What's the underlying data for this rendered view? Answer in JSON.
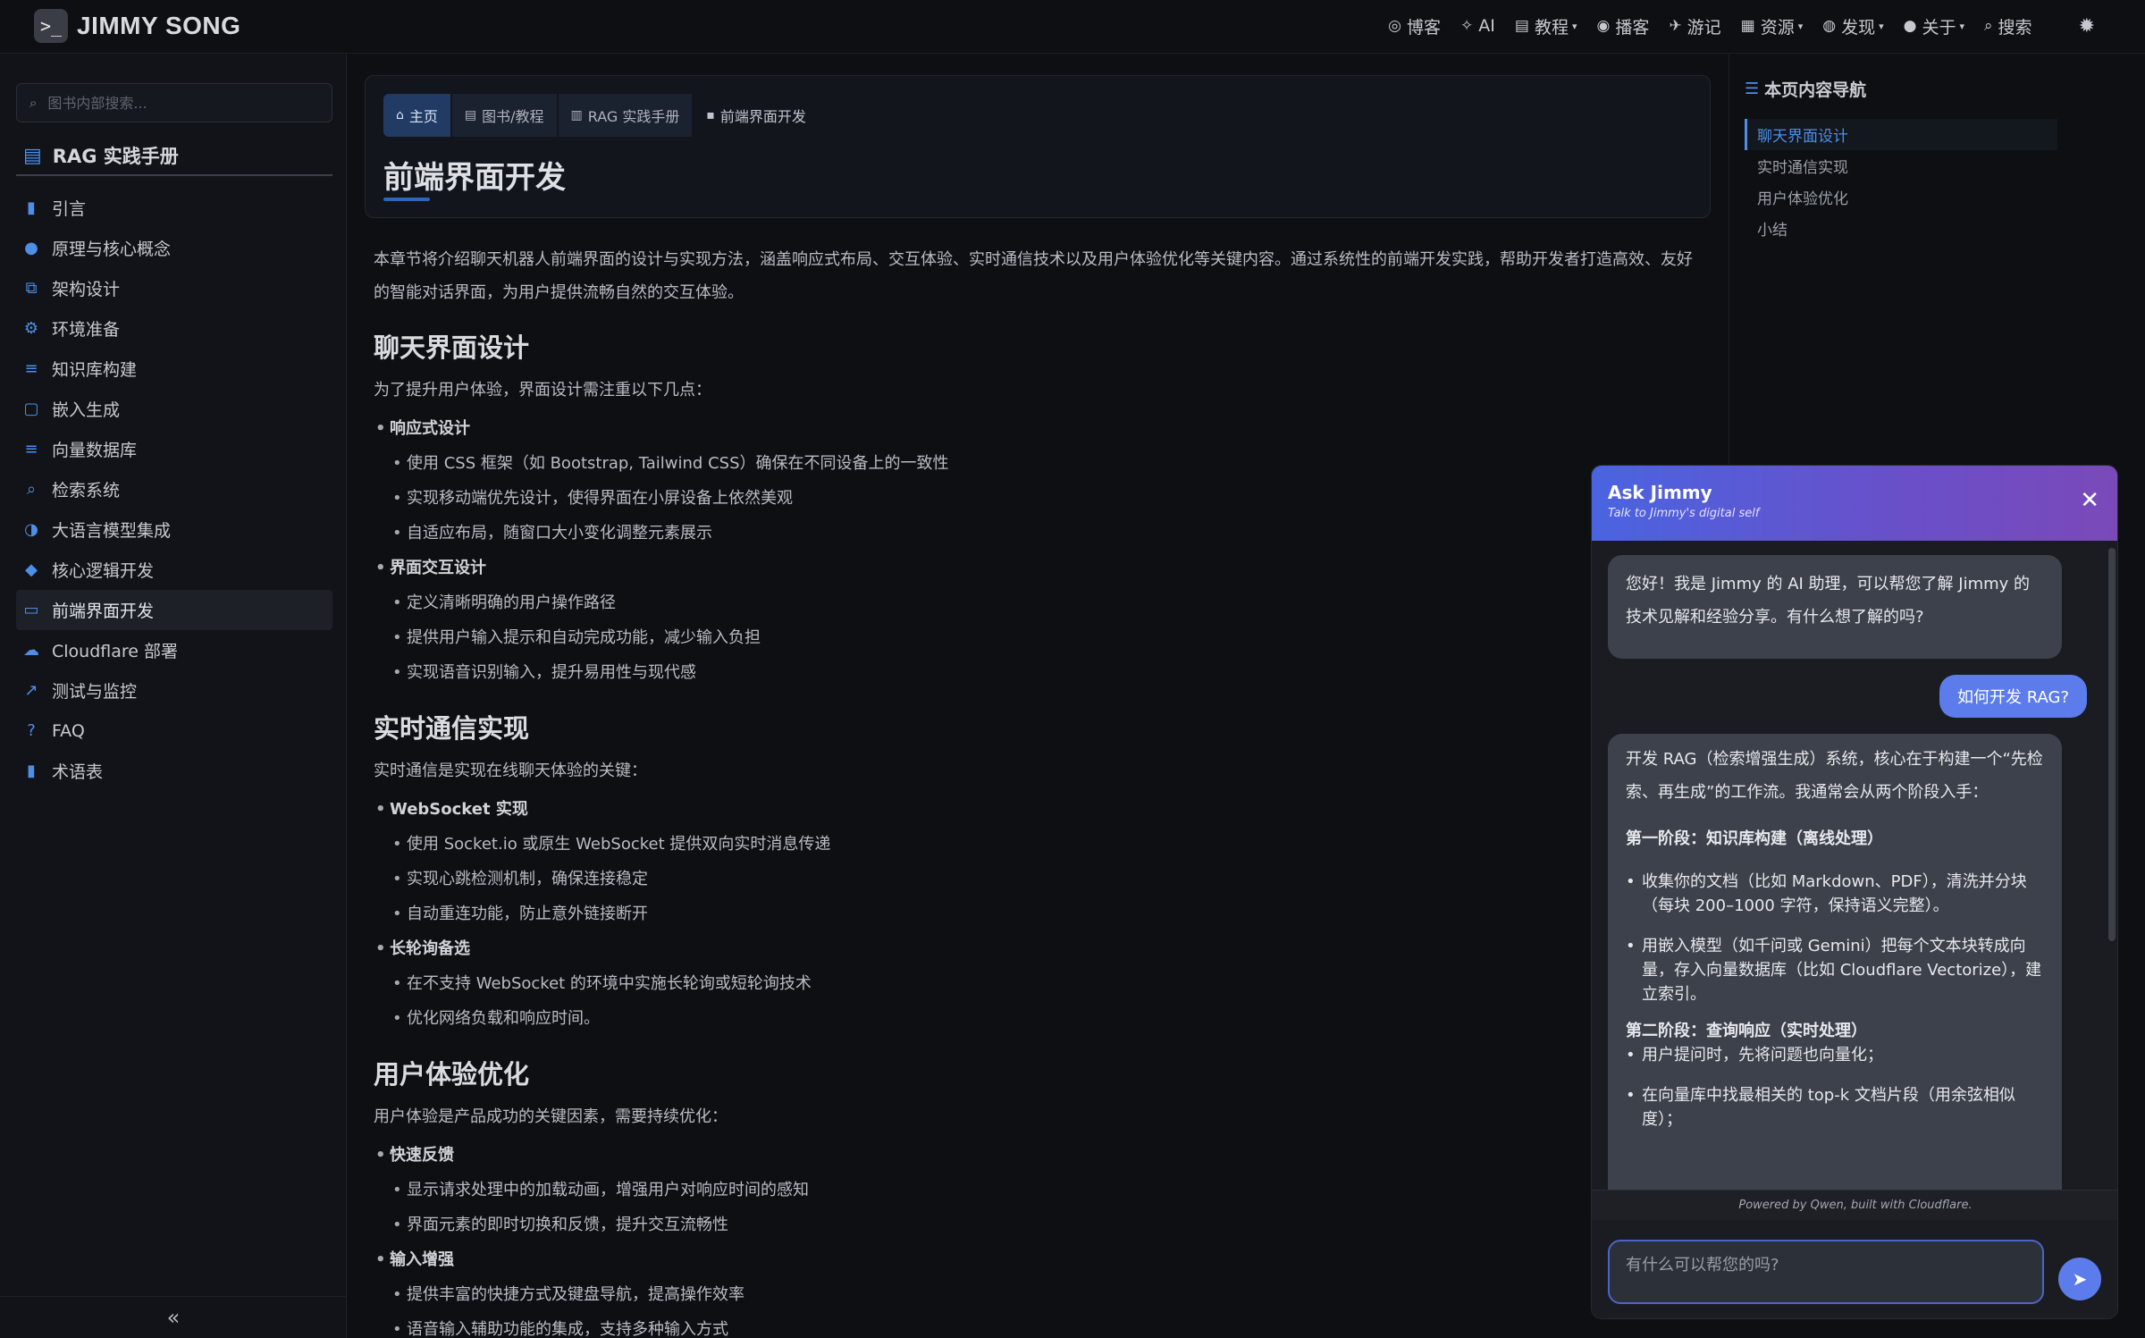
{
  "brand": {
    "logo": ">_",
    "name": "JIMMY SONG"
  },
  "nav": [
    {
      "icon": "rss-icon",
      "glyph": "◎",
      "label": "博客",
      "caret": false
    },
    {
      "icon": "magic-wand-icon",
      "glyph": "✧",
      "label": "AI",
      "caret": false
    },
    {
      "icon": "book-icon",
      "glyph": "▤",
      "label": "教程",
      "caret": true
    },
    {
      "icon": "podcast-icon",
      "glyph": "◉",
      "label": "播客",
      "caret": false
    },
    {
      "icon": "plane-icon",
      "glyph": "✈",
      "label": "游记",
      "caret": false
    },
    {
      "icon": "archive-icon",
      "glyph": "▦",
      "label": "资源",
      "caret": true
    },
    {
      "icon": "compass-icon",
      "glyph": "◍",
      "label": "发现",
      "caret": true
    },
    {
      "icon": "user-icon",
      "glyph": "●",
      "label": "关于",
      "caret": true
    },
    {
      "icon": "search-icon",
      "glyph": "⌕",
      "label": "搜索",
      "caret": false
    }
  ],
  "sidebar": {
    "search_placeholder": "图书内部搜索...",
    "book_title": "RAG 实践手册",
    "items": [
      {
        "label": "引言",
        "glyph": "▮"
      },
      {
        "label": "原理与核心概念",
        "glyph": "●"
      },
      {
        "label": "架构设计",
        "glyph": "⧉"
      },
      {
        "label": "环境准备",
        "glyph": "⚙"
      },
      {
        "label": "知识库构建",
        "glyph": "≡"
      },
      {
        "label": "嵌入生成",
        "glyph": "▢"
      },
      {
        "label": "向量数据库",
        "glyph": "≡"
      },
      {
        "label": "检索系统",
        "glyph": "⌕"
      },
      {
        "label": "大语言模型集成",
        "glyph": "◑"
      },
      {
        "label": "核心逻辑开发",
        "glyph": "◆"
      },
      {
        "label": "前端界面开发",
        "glyph": "▭",
        "active": true
      },
      {
        "label": "Cloudflare 部署",
        "glyph": "☁"
      },
      {
        "label": "测试与监控",
        "glyph": "↗"
      },
      {
        "label": "FAQ",
        "glyph": "?"
      },
      {
        "label": "术语表",
        "glyph": "▮"
      }
    ],
    "collapse": "«"
  },
  "breadcrumbs": [
    {
      "label": "主页",
      "glyph": "⌂"
    },
    {
      "label": "图书/教程",
      "glyph": "▤"
    },
    {
      "label": "RAG 实践手册",
      "glyph": "▥"
    },
    {
      "label": "前端界面开发",
      "glyph": "▪"
    }
  ],
  "page_title": "前端界面开发",
  "content": {
    "intro": "本章节将介绍聊天机器人前端界面的设计与实现方法，涵盖响应式布局、交互体验、实时通信技术以及用户体验优化等关键内容。通过系统性的前端开发实践，帮助开发者打造高效、友好的智能对话界面，为用户提供流畅自然的交互体验。",
    "sections": [
      {
        "title": "聊天界面设计",
        "lead": "为了提升用户体验，界面设计需注重以下几点：",
        "groups": [
          {
            "label": "响应式设计",
            "items": [
              "使用 CSS 框架（如 Bootstrap, Tailwind CSS）确保在不同设备上的一致性",
              "实现移动端优先设计，使得界面在小屏设备上依然美观",
              "自适应布局，随窗口大小变化调整元素展示"
            ]
          },
          {
            "label": "界面交互设计",
            "items": [
              "定义清晰明确的用户操作路径",
              "提供用户输入提示和自动完成功能，减少输入负担",
              "实现语音识别输入，提升易用性与现代感"
            ]
          }
        ]
      },
      {
        "title": "实时通信实现",
        "lead": "实时通信是实现在线聊天体验的关键：",
        "groups": [
          {
            "label": "WebSocket 实现",
            "items": [
              "使用 Socket.io 或原生 WebSocket 提供双向实时消息传递",
              "实现心跳检测机制，确保连接稳定",
              "自动重连功能，防止意外链接断开"
            ]
          },
          {
            "label": "长轮询备选",
            "items": [
              "在不支持 WebSocket 的环境中实施长轮询或短轮询技术",
              "优化网络负载和响应时间。"
            ]
          }
        ]
      },
      {
        "title": "用户体验优化",
        "lead": "用户体验是产品成功的关键因素，需要持续优化：",
        "groups": [
          {
            "label": "快速反馈",
            "items": [
              "显示请求处理中的加载动画，增强用户对响应时间的感知",
              "界面元素的即时切换和反馈，提升交互流畅性"
            ]
          },
          {
            "label": "输入增强",
            "items": [
              "提供丰富的快捷方式及键盘导航，提高操作效率",
              "语音输入辅助功能的集成，支持多种输入方式"
            ]
          }
        ]
      }
    ]
  },
  "toc": {
    "title": "本页内容导航",
    "items": [
      "聊天界面设计",
      "实时通信实现",
      "用户体验优化",
      "小结"
    ]
  },
  "chat": {
    "title": "Ask Jimmy",
    "subtitle": "Talk to Jimmy's digital self",
    "close": "✕",
    "greeting": "您好！我是 Jimmy 的 AI 助理，可以帮您了解 Jimmy 的技术见解和经验分享。有什么想了解的吗?",
    "user_msg": "如何开发 RAG?",
    "reply_intro": "开发 RAG（检索增强生成）系统，核心在于构建一个“先检索、再生成”的工作流。我通常会从两个阶段入手：",
    "phase1_title": "第一阶段：知识库构建（离线处理）",
    "phase1_items": [
      "收集你的文档（比如 Markdown、PDF），清洗并分块（每块 200–1000 字符，保持语义完整）。",
      "用嵌入模型（如千问或 Gemini）把每个文本块转成向量，存入向量数据库（比如 Cloudflare Vectorize），建立索引。"
    ],
    "phase2_title": "第二阶段：查询响应（实时处理）",
    "phase2_items": [
      "用户提问时，先将问题也向量化；",
      "在向量库中找最相关的 top-k 文档片段（用余弦相似度）；"
    ],
    "footer": "Powered by Qwen, built with Cloudflare.",
    "input_placeholder": "有什么可以帮您的吗?",
    "send": "➤"
  }
}
